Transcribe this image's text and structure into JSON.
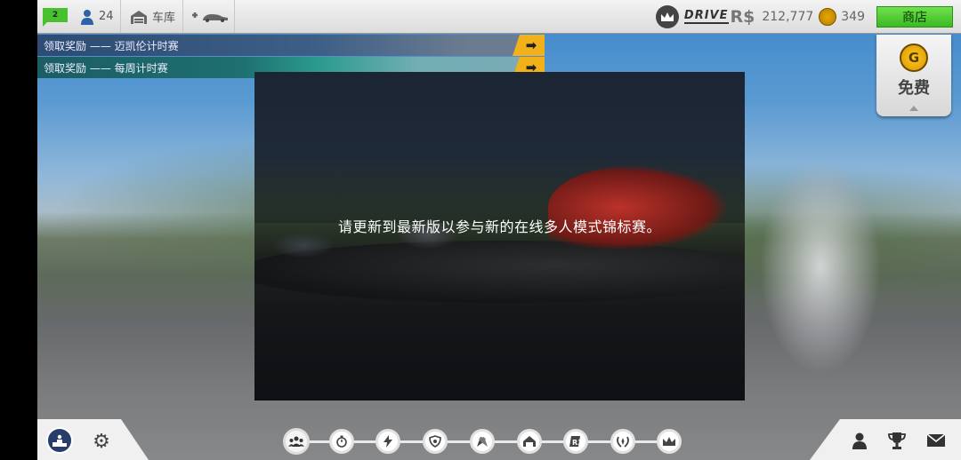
{
  "topbar": {
    "level": "2",
    "fans": "24",
    "garage_label": "车库",
    "drive_label": "DRIVE",
    "rs_label": "R$",
    "money": "212,777",
    "gold": "349",
    "shop_label": "商店"
  },
  "banners": [
    {
      "text": "领取奖励 —— 迈凯伦计时赛"
    },
    {
      "text": "领取奖励 —— 每周计时赛"
    }
  ],
  "free": {
    "label": "免费"
  },
  "dialog": {
    "message": "请更新到最新版以参与新的在线多人模式锦标赛。"
  },
  "icons": {
    "fans": "person-icon",
    "garage": "garage-icon",
    "tune": "car-tune-icon",
    "crown": "crown-icon",
    "gold": "gold-coin-icon",
    "arrow": "arrow-right-icon",
    "podium": "podium-icon",
    "settings": "gear-icon",
    "profile": "profile-icon",
    "trophy": "trophy-icon",
    "mail": "mail-icon"
  },
  "nav_nodes": [
    "multiplayer-icon",
    "stopwatch-icon",
    "lightning-icon",
    "shield-icon",
    "flags-icon",
    "home-icon",
    "r3-icon",
    "wreath-icon",
    "crown-icon"
  ],
  "colors": {
    "shop_green": "#49c12f",
    "arrow_yellow": "#f2b01a",
    "podium_blue": "#273e6b"
  }
}
